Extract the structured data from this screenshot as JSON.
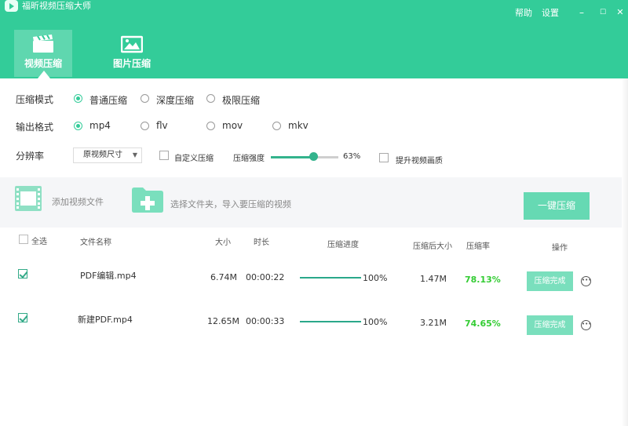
{
  "app": {
    "title": "福昕视频压缩大师",
    "help": "帮助",
    "settings": "设置",
    "minimize": "–",
    "maximize": "☐",
    "close": "✕"
  },
  "tabs": [
    {
      "label": "视频压缩",
      "icon": "video-clapper-icon",
      "active": true
    },
    {
      "label": "图片压缩",
      "icon": "image-icon",
      "active": false
    }
  ],
  "options": {
    "mode_label": "压缩模式",
    "modes": [
      "普通压缩",
      "深度压缩",
      "极限压缩"
    ],
    "mode_selected": "普通压缩",
    "format_label": "输出格式",
    "formats": [
      "mp4",
      "flv",
      "mov",
      "mkv"
    ],
    "format_selected": "mp4",
    "resolution_label": "分辨率",
    "resolution_value": "原视频尺寸",
    "custom_label": "自定义压缩",
    "strength_label": "压缩强度",
    "strength_percent": 63,
    "strength_text": "63%",
    "quality_label": "提升视频画质"
  },
  "actions": {
    "add_video": "添加视频文件",
    "add_folder": "选择文件夹，导入要压缩的视频",
    "compress_all": "一键压缩"
  },
  "table": {
    "headers": {
      "select_all": "全选",
      "name": "文件名称",
      "size": "大小",
      "duration": "时长",
      "progress": "压缩进度",
      "size_after": "压缩后大小",
      "ratio": "压缩率",
      "action": "操作"
    },
    "rows": [
      {
        "checked": true,
        "name": "PDF编辑.mp4",
        "size": "6.74M",
        "duration": "00:00:22",
        "progress": 1.0,
        "progress_text": "100%",
        "size_after": "1.47M",
        "ratio": "78.13%",
        "status": "压缩完成"
      },
      {
        "checked": true,
        "name": "新建PDF.mp4",
        "size": "12.65M",
        "duration": "00:00:33",
        "progress": 1.0,
        "progress_text": "100%",
        "size_after": "3.21M",
        "ratio": "74.65%",
        "status": "压缩完成"
      }
    ]
  },
  "colors": {
    "brand": "#33cc99",
    "button": "#66d9b3",
    "ratio_text": "#33cc33"
  }
}
